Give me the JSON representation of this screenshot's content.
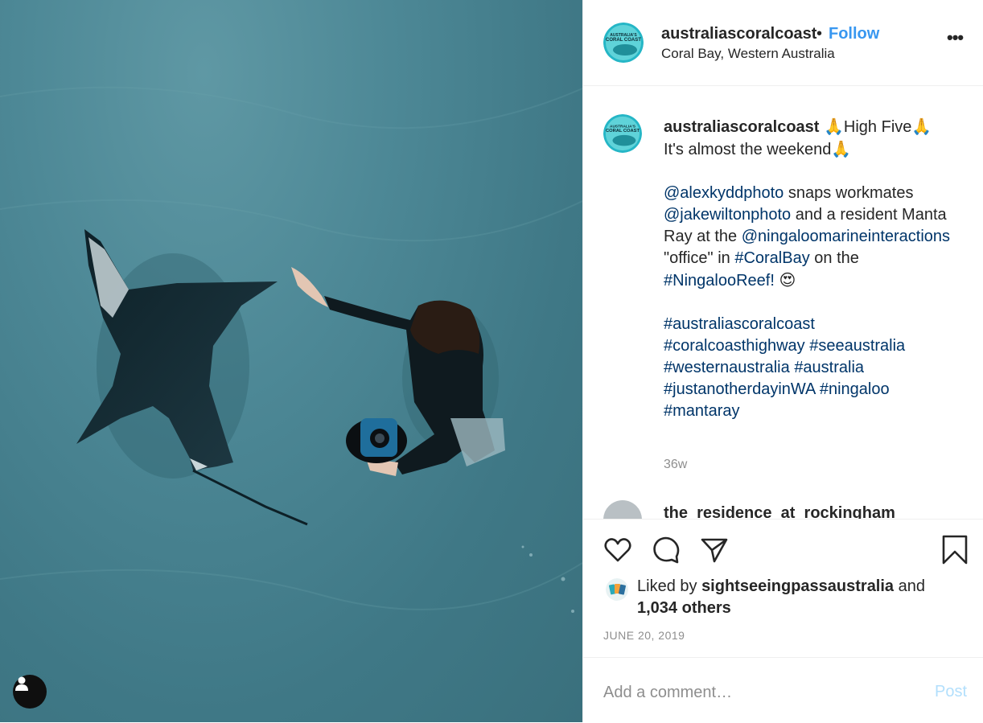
{
  "post": {
    "author": "australiascoralcoast",
    "follow_label": "Follow",
    "separator": "•",
    "location": "Coral Bay, Western Australia",
    "more_label": "•••",
    "avatar_text": "AUSTRALIA'S CORAL COAST"
  },
  "caption": {
    "author": "australiascoralcoast",
    "line1": "High Five",
    "line2": "It's almost the weekend",
    "pray_emoji": "🙏",
    "mention1": "@alexkyddphoto",
    "text1": " snaps workmates ",
    "mention2": "@jakewiltonphoto",
    "text2": " and a resident Manta Ray at the ",
    "mention3": "@ningaloomarineinteractions",
    "text3": " \"office\" in ",
    "tag1": "#CoralBay",
    "text4": " on the ",
    "tag2": "#NingalooReef!",
    "heart_eyes": "😍",
    "tags": [
      "#australiascoralcoast",
      "#coralcoasthighway",
      "#seeaustralia",
      "#westernaustralia",
      "#australia",
      "#justanotherdayinWA",
      "#ningaloo",
      "#mantaray"
    ],
    "time_ago": "36w"
  },
  "next_comment": {
    "author": "the_residence_at_rockingham"
  },
  "likes": {
    "prefix": "Liked by ",
    "user": "sightseeingpassaustralia",
    "mid": " and",
    "others": "1,034 others"
  },
  "date": "JUNE 20, 2019",
  "comment_box": {
    "placeholder": "Add a comment…",
    "post_label": "Post"
  },
  "colors": {
    "link": "#003569",
    "follow": "#3897f0",
    "muted": "#8e8e8e",
    "post_disabled": "#b2dffc",
    "water": "#4d8896"
  },
  "icons": [
    "heart-icon",
    "comment-icon",
    "share-icon",
    "bookmark-icon",
    "user-tag-icon",
    "more-icon"
  ]
}
